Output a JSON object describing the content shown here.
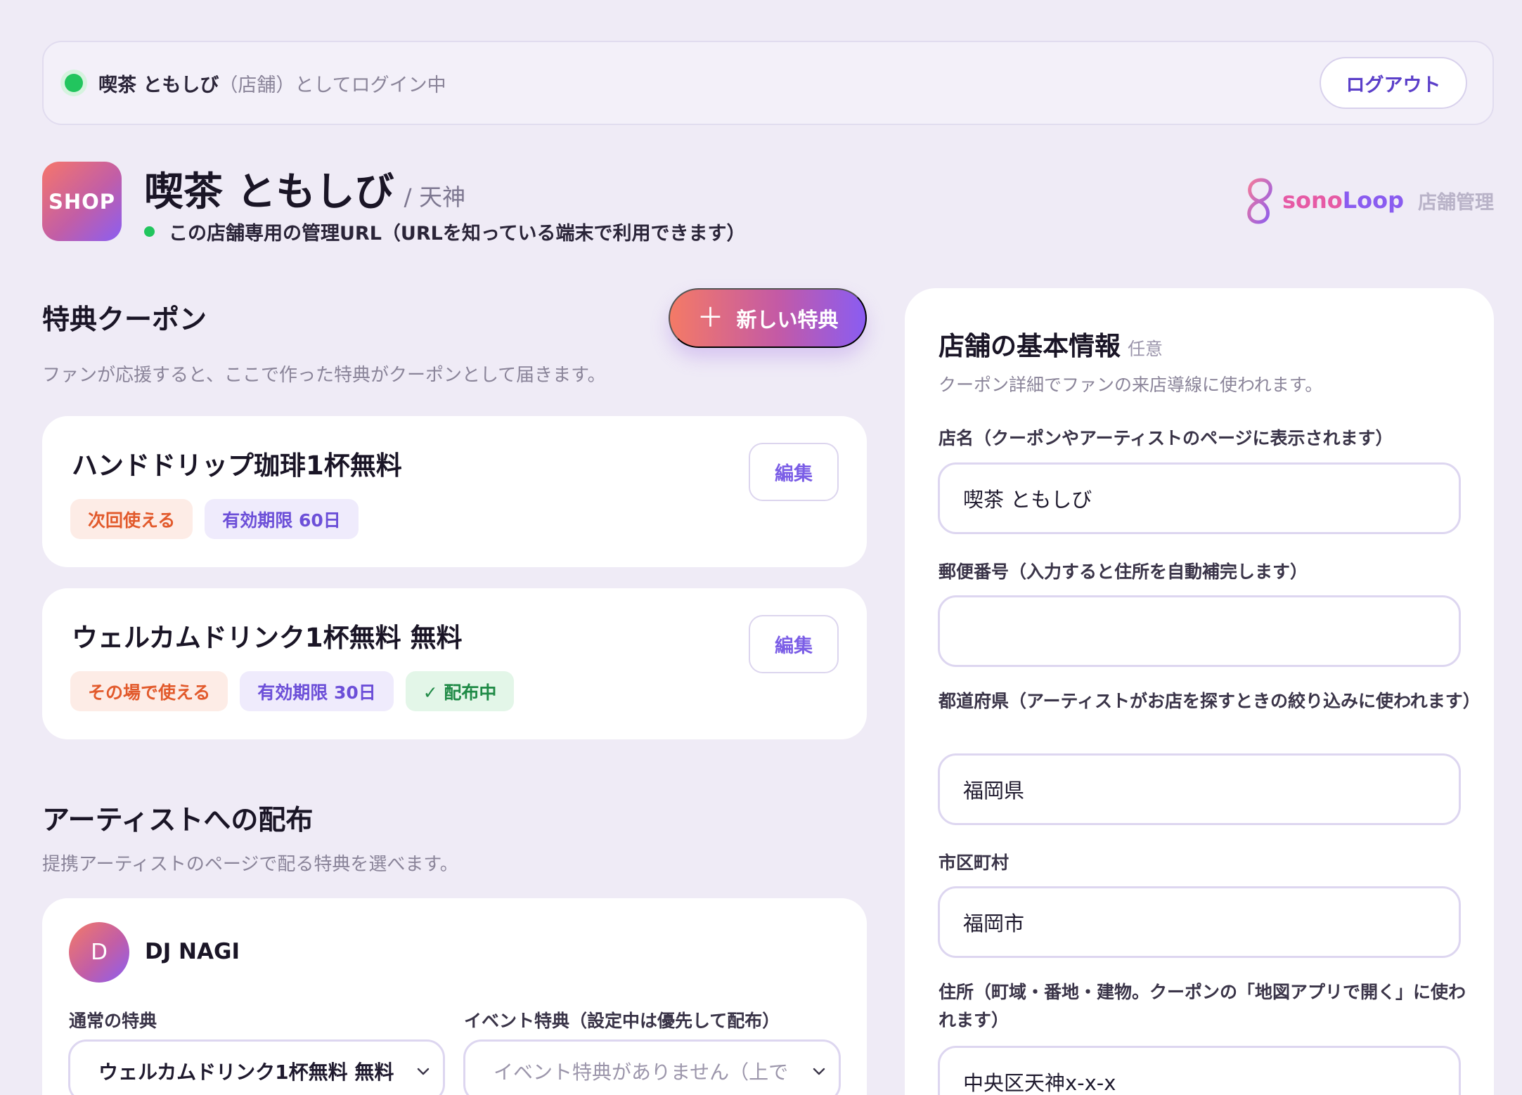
{
  "login_bar": {
    "shop_name": "喫茶 ともしび",
    "suffix": "（店舗）としてログイン中",
    "logout_label": "ログアウト"
  },
  "header": {
    "logo_text": "SHOP",
    "shop_name": "喫茶 ともしび",
    "area": "/ 天神",
    "admin_note": "この店舗専用の管理URL（URLを知っている端末で利用できます）",
    "brand_sono": "sono",
    "brand_loop": "Loop",
    "brand_sub": "店舗管理"
  },
  "coupons": {
    "title": "特典クーポン",
    "description": "ファンが応援すると、ここで作った特典がクーポンとして届きます。",
    "new_button_label": "新しい特典",
    "items": [
      {
        "title": "ハンドドリップ珈琲1杯無料",
        "badges": [
          "次回使える",
          "有効期限 60日"
        ],
        "edit_label": "編集"
      },
      {
        "title": "ウェルカムドリンク1杯無料 無料",
        "badges": [
          "その場で使える",
          "有効期限 30日",
          "✓ 配布中"
        ],
        "edit_label": "編集"
      }
    ]
  },
  "distribution": {
    "title": "アーティストへの配布",
    "description": "提携アーティストのページで配る特典を選べます。",
    "artist": {
      "initial": "D",
      "name": "DJ NAGI",
      "normal_label": "通常の特典",
      "normal_value": "ウェルカムドリンク1杯無料 無料",
      "event_label": "イベント特典（設定中は優先して配布）",
      "event_value": "イベント特典がありません（上で"
    }
  },
  "shop_info": {
    "title": "店舗の基本情報",
    "optional": "任意",
    "description": "クーポン詳細でファンの来店導線に使われます。",
    "fields": [
      {
        "label": "店名（クーポンやアーティストのページに表示されます）",
        "value": "喫茶 ともしび"
      },
      {
        "label": "郵便番号（入力すると住所を自動補完します）",
        "value": ""
      },
      {
        "label": "都道府県（アーティストがお店を探すときの絞り込みに使われます）",
        "value": "福岡県"
      },
      {
        "label": "市区町村",
        "value": "福岡市"
      },
      {
        "label": "住所（町域・番地・建物。クーポンの「地図アプリで開く」に使われます）",
        "value": "中央区天神x-x-x"
      }
    ]
  },
  "icons": {
    "status": "status-dot-icon",
    "plus": "plus-icon",
    "chevron": "chevron-down-icon",
    "brand": "loop-logo-icon"
  },
  "colors": {
    "accent": "#8a5cf0",
    "accent_warm": "#f47a66",
    "online_green": "#22c55e",
    "background": "#efebf6"
  }
}
